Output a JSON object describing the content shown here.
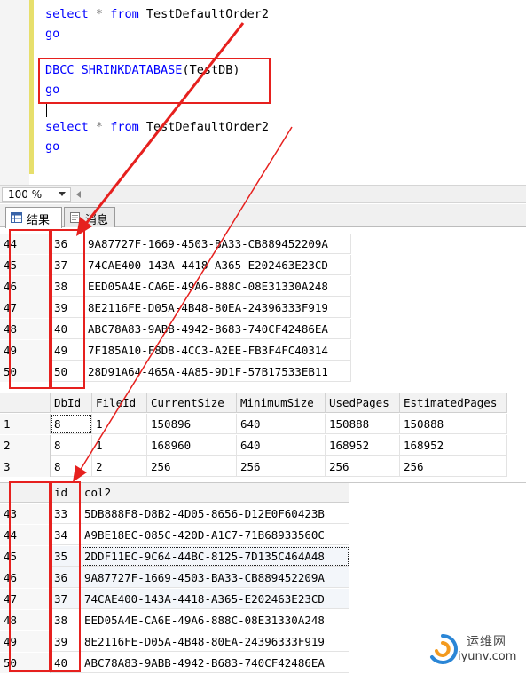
{
  "editor": {
    "lines": [
      {
        "kw": "select",
        "star": "*",
        "from": "from",
        "table": "TestDefaultOrder2"
      },
      {
        "go": "go"
      },
      {
        "cmd": "DBCC SHRINKDATABASE",
        "arg": "(TestDB)"
      },
      {
        "go": "go"
      },
      {
        "kw": "select",
        "star": "*",
        "from": "from",
        "table": "TestDefaultOrder2"
      },
      {
        "go": "go"
      }
    ]
  },
  "status": {
    "zoom": "100 %"
  },
  "tabs": [
    {
      "label": "结果",
      "icon": "grid-icon"
    },
    {
      "label": "消息",
      "icon": "message-icon"
    }
  ],
  "grid1": {
    "rows": [
      {
        "n": "44",
        "id": "36",
        "col2": "9A87727F-1669-4503-BA33-CB889452209A"
      },
      {
        "n": "45",
        "id": "37",
        "col2": "74CAE400-143A-4418-A365-E202463E23CD"
      },
      {
        "n": "46",
        "id": "38",
        "col2": "EED05A4E-CA6E-49A6-888C-08E31330A248"
      },
      {
        "n": "47",
        "id": "39",
        "col2": "8E2116FE-D05A-4B48-80EA-24396333F919"
      },
      {
        "n": "48",
        "id": "40",
        "col2": "ABC78A83-9ABB-4942-B683-740CF42486EA"
      },
      {
        "n": "49",
        "id": "49",
        "col2": "7F185A10-F8D8-4CC3-A2EE-FB3F4FC40314"
      },
      {
        "n": "50",
        "id": "50",
        "col2": "28D91A64-465A-4A85-9D1F-57B17533EB11"
      }
    ]
  },
  "grid2": {
    "headers": [
      "DbId",
      "FileId",
      "CurrentSize",
      "MinimumSize",
      "UsedPages",
      "EstimatedPages"
    ],
    "rows": [
      {
        "n": "1",
        "cells": [
          "8",
          "1",
          "150896",
          "640",
          "150888",
          "150888"
        ]
      },
      {
        "n": "2",
        "cells": [
          "8",
          "1",
          "168960",
          "640",
          "168952",
          "168952"
        ]
      },
      {
        "n": "3",
        "cells": [
          "8",
          "2",
          "256",
          "256",
          "256",
          "256"
        ]
      }
    ]
  },
  "grid3": {
    "headers": [
      "id",
      "col2"
    ],
    "rows": [
      {
        "n": "43",
        "id": "33",
        "col2": "5DB888F8-D8B2-4D05-8656-D12E0F60423B"
      },
      {
        "n": "44",
        "id": "34",
        "col2": "A9BE18EC-085C-420D-A1C7-71B68933560C"
      },
      {
        "n": "45",
        "id": "35",
        "col2": "2DDF11EC-9C64-44BC-8125-7D135C464A48"
      },
      {
        "n": "46",
        "id": "36",
        "col2": "9A87727F-1669-4503-BA33-CB889452209A"
      },
      {
        "n": "47",
        "id": "37",
        "col2": "74CAE400-143A-4418-A365-E202463E23CD"
      },
      {
        "n": "48",
        "id": "38",
        "col2": "EED05A4E-CA6E-49A6-888C-08E31330A248"
      },
      {
        "n": "49",
        "id": "39",
        "col2": "8E2116FE-D05A-4B48-80EA-24396333F919"
      },
      {
        "n": "50",
        "id": "40",
        "col2": "ABC78A83-9ABB-4942-B683-740CF42486EA"
      }
    ]
  },
  "watermark": {
    "name": "运维网",
    "domain": "iyunv.com"
  },
  "colors": {
    "annotation": "#e6201e",
    "keyword": "#0000ff",
    "function": "#ff00ff"
  }
}
